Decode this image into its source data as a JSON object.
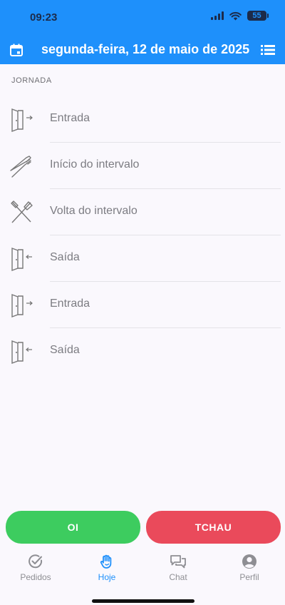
{
  "status": {
    "time": "09:23",
    "battery": "55"
  },
  "header": {
    "date_title": "segunda-feira, 12 de maio de 2025"
  },
  "section": {
    "label": "JORNADA"
  },
  "entries": [
    {
      "label": "Entrada",
      "icon": "door-enter-icon"
    },
    {
      "label": "Início do intervalo",
      "icon": "fork-knife-icon"
    },
    {
      "label": "Volta do intervalo",
      "icon": "crossed-utensils-icon"
    },
    {
      "label": "Saída",
      "icon": "door-exit-icon"
    },
    {
      "label": "Entrada",
      "icon": "door-enter-icon"
    },
    {
      "label": "Saída",
      "icon": "door-exit-icon"
    }
  ],
  "actions": {
    "oi_label": "OI",
    "tchau_label": "TCHAU"
  },
  "tabs": [
    {
      "label": "Pedidos",
      "icon": "check-circle-icon",
      "active": false
    },
    {
      "label": "Hoje",
      "icon": "hand-icon",
      "active": true
    },
    {
      "label": "Chat",
      "icon": "chat-icon",
      "active": false
    },
    {
      "label": "Perfil",
      "icon": "person-icon",
      "active": false
    }
  ],
  "colors": {
    "primary": "#1e90fb",
    "oi": "#3dcc5f",
    "tchau": "#ea4a5b",
    "inactive": "#8e8e93"
  }
}
